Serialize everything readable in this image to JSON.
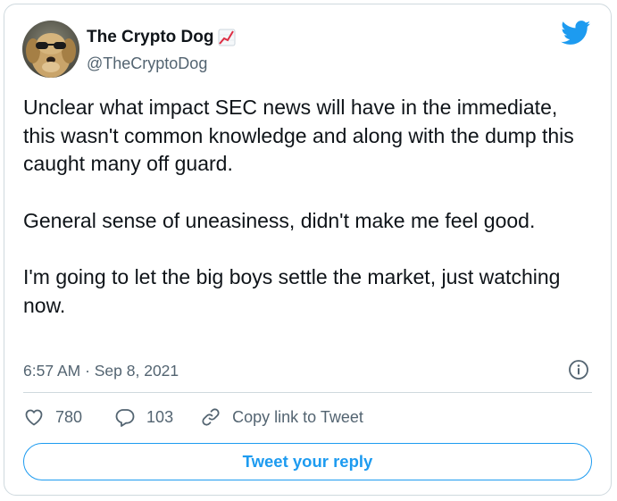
{
  "author": {
    "display_name": "The Crypto Dog",
    "name_emoji": "chart-increasing-emoji",
    "handle": "@TheCryptoDog",
    "avatar": "dog-with-sunglasses-avatar"
  },
  "brand": {
    "icon": "twitter-bird-icon",
    "color": "#1d9bf0"
  },
  "tweet": {
    "paragraphs": [
      "Unclear what impact SEC news will have in the immediate, this wasn't common knowledge and along with the dump this caught many off guard.",
      "General sense of uneasiness, didn't make me feel good.",
      "I'm going to let the big boys settle the market, just watching now."
    ],
    "timestamp": "6:57 AM · Sep 8, 2021"
  },
  "actions": {
    "likes": "780",
    "replies": "103",
    "copy_link_label": "Copy link to Tweet"
  },
  "reply_button_label": "Tweet your reply",
  "colors": {
    "text_primary": "#0f1419",
    "text_secondary": "#536471",
    "border": "#cfd9de",
    "accent": "#1d9bf0"
  }
}
